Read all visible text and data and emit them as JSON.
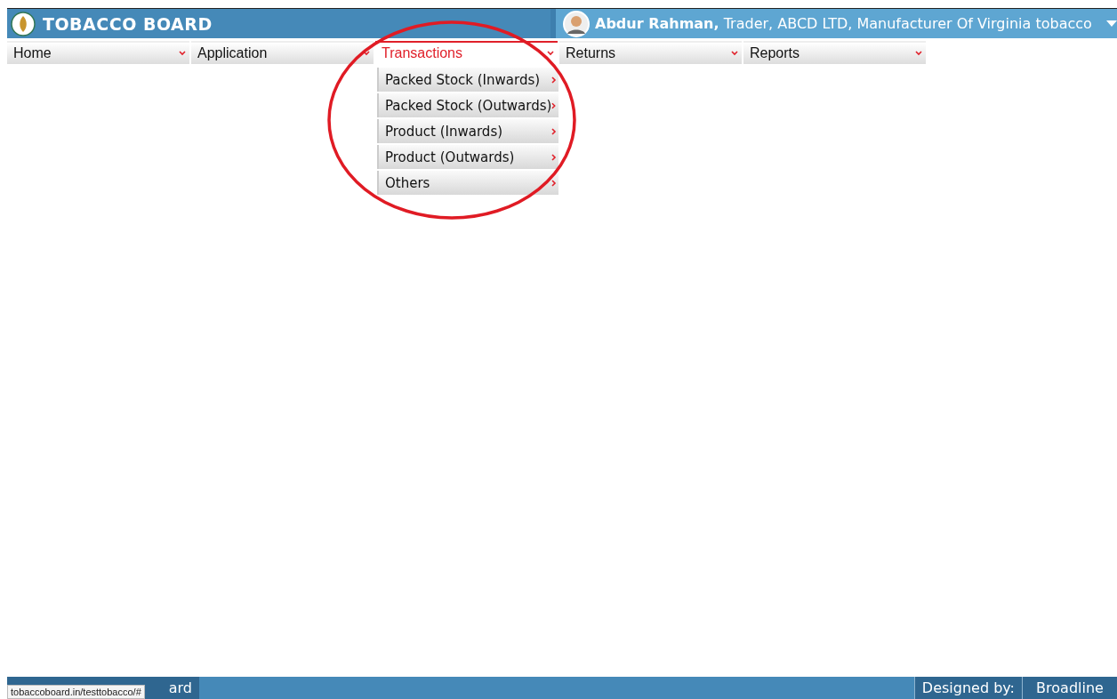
{
  "header": {
    "title": "TOBACCO BOARD",
    "user": {
      "name": "Abdur Rahman,",
      "details": "Trader, ABCD LTD, Manufacturer Of Virginia tobacco"
    }
  },
  "menu": [
    {
      "label": "Home",
      "selected": false
    },
    {
      "label": "Application",
      "selected": false
    },
    {
      "label": "Transactions",
      "selected": true,
      "submenu": [
        "Packed Stock (Inwards)",
        "Packed Stock (Outwards)",
        "Product (Inwards)",
        "Product (Outwards)",
        "Others"
      ]
    },
    {
      "label": "Returns",
      "selected": false
    },
    {
      "label": "Reports",
      "selected": false
    }
  ],
  "footer": {
    "left": "ard",
    "designed_by": "Designed by:",
    "company": "Broadline"
  },
  "status_url": "tobaccoboard.in/testtobacco/#"
}
